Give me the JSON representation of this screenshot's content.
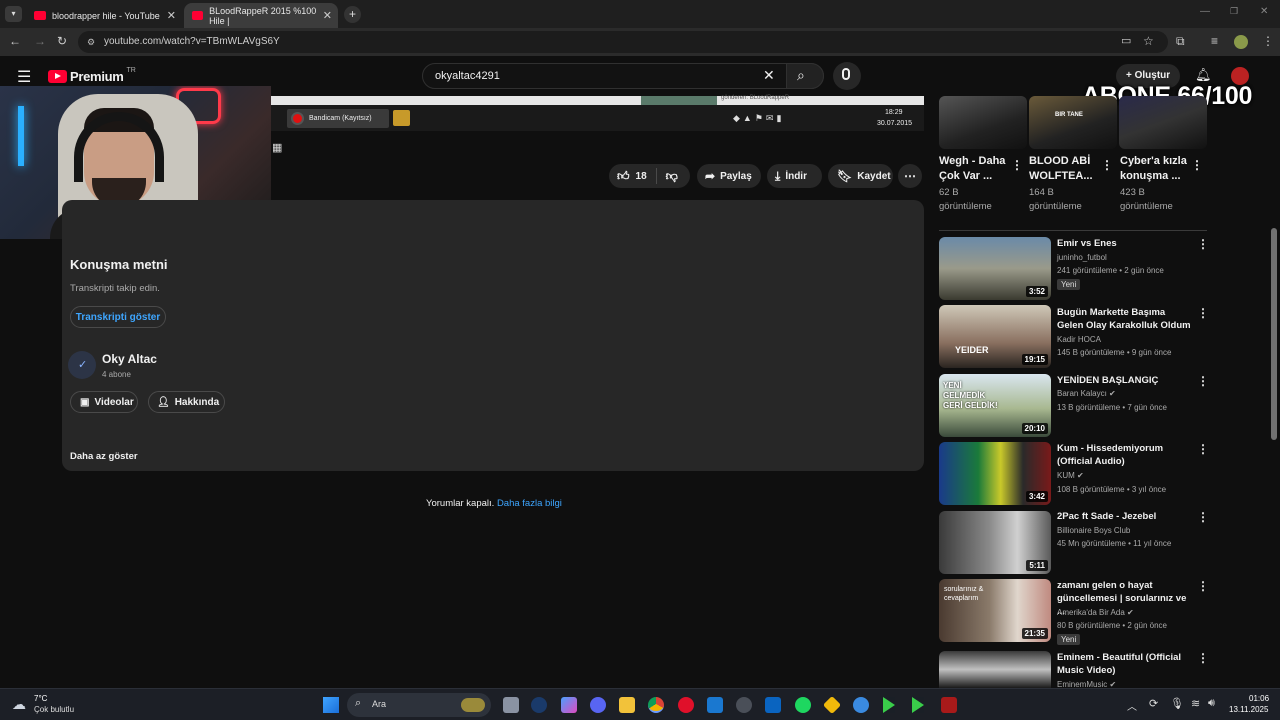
{
  "browser": {
    "tabs": [
      {
        "title": "bloodrapper hile - YouTube",
        "active": false
      },
      {
        "title": "BLoodRappeR 2015 %100 Hile |",
        "active": true
      }
    ],
    "url": "youtube.com/watch?v=TBmWLAVgS6Y"
  },
  "youtube": {
    "logo_text": "Premium",
    "region": "TR",
    "search_value": "okyaltac4291",
    "create_label": "Oluştur"
  },
  "overlay": {
    "abone_counter": "ABONE 66/100"
  },
  "player": {
    "recorder_label": "Bandicam (Kayıtsız)",
    "sender_label": "gönderen: BLoodRappeR",
    "tray_time": "18:29",
    "tray_date": "30.07.2015"
  },
  "actions": {
    "like_count": "18",
    "share_label": "Paylaş",
    "download_label": "İndir",
    "save_label": "Kaydet"
  },
  "description": {
    "transcript_heading": "Konuşma metni",
    "transcript_sub": "Transkripti takip edin.",
    "transcript_button": "Transkripti göster",
    "channel_name": "Oky Altac",
    "channel_subs": "4 abone",
    "videos_button": "Videolar",
    "about_button": "Hakkında",
    "show_less": "Daha az göster"
  },
  "comments": {
    "disabled_text": "Yorumlar kapalı.",
    "learn_more": "Daha fazla bilgi"
  },
  "shorts": [
    {
      "title": "Wegh - Daha Çok Var ...",
      "views": "62 B görüntüleme"
    },
    {
      "title": "BLOOD ABİ WOLFTEA...",
      "views": "164 B görüntüleme",
      "thumb_text": "BIR TANE"
    },
    {
      "title": "Cyber'a kızla konuşma ...",
      "views": "423 B görüntüleme"
    }
  ],
  "videos": [
    {
      "title": "Emir vs Enes",
      "channel": "juninho_futbol",
      "meta": "241 görüntüleme • 2 gün önce",
      "duration": "3:52",
      "badge": "Yeni",
      "verified": false
    },
    {
      "title": "Bugün Markette Başıma Gelen Olay Karakolluk Oldum",
      "channel": "Kadir HOCA",
      "meta": "145 B görüntüleme • 9 gün önce",
      "duration": "19:15",
      "verified": false,
      "thumb_text": "YEIDER"
    },
    {
      "title": "YENİDEN BAŞLANGIÇ",
      "channel": "Baran Kalaycı",
      "meta": "13 B görüntüleme • 7 gün önce",
      "duration": "20:10",
      "verified": true,
      "thumb_text": "YENİ GELMEDİK GERİ GELDİK!"
    },
    {
      "title": "Kum - Hissedemiyorum (Official Audio)",
      "channel": "KUM",
      "meta": "108 B görüntüleme • 3 yıl önce",
      "duration": "3:42",
      "verified": true
    },
    {
      "title": "2Pac ft Sade - Jezebel",
      "channel": "Billionaire Boys Club",
      "meta": "45 Mn görüntüleme • 11 yıl önce",
      "duration": "5:11",
      "verified": false
    },
    {
      "title": "zamanı gelen o hayat güncellemesi | sorularınız ve ...",
      "channel": "Amerika'da Bir Ada",
      "meta": "80 B görüntüleme • 2 gün önce",
      "duration": "21:35",
      "badge": "Yeni",
      "verified": true,
      "thumb_text": "sorularınız & cevaplarım"
    },
    {
      "title": "Eminem - Beautiful (Official Music Video)",
      "channel": "EminemMusic",
      "meta": "",
      "duration": "",
      "verified": true
    }
  ],
  "taskbar": {
    "weather_temp": "7°C",
    "weather_desc": "Çok bulutlu",
    "search_label": "Ara",
    "time": "01:06",
    "date": "13.11.2025"
  },
  "colors": {
    "youtube_red": "#ff0033",
    "link_blue": "#3ea6ff",
    "bg": "#0f0f0f",
    "panel": "#272727"
  }
}
